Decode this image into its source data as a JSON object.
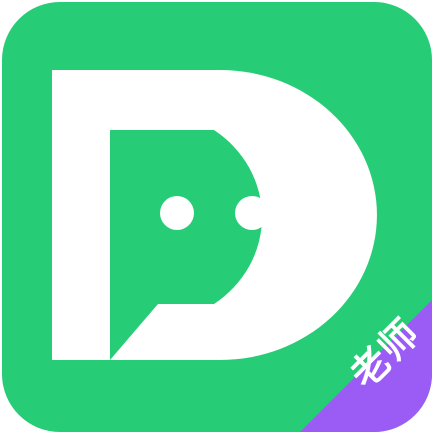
{
  "app_icon": {
    "background_color": "#26cd76",
    "glyph_color": "#ffffff",
    "glyph_icon": "speech-bubble-letter-d-icon",
    "badge": {
      "label": "老师",
      "color": "#9b5cf6"
    }
  }
}
